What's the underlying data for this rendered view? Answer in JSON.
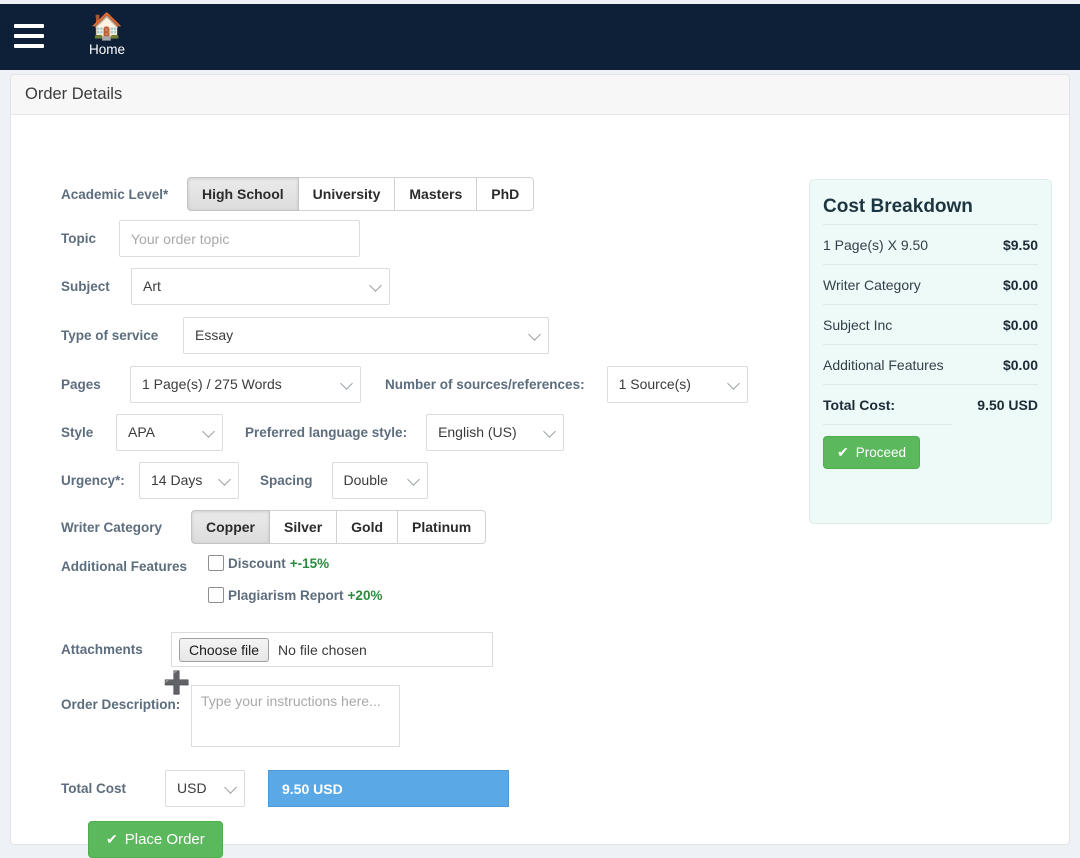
{
  "navbar": {
    "menu_icon": "hamburger-icon",
    "home_icon": "home-icon",
    "home_label": "Home"
  },
  "card": {
    "header_title": "Order Details"
  },
  "form": {
    "academic_level": {
      "label": "Academic Level*",
      "options": [
        "High School",
        "University",
        "Masters",
        "PhD"
      ],
      "selected": "High School"
    },
    "topic": {
      "label": "Topic",
      "placeholder": "Your order topic",
      "value": ""
    },
    "subject": {
      "label": "Subject",
      "value": "Art"
    },
    "type_of_service": {
      "label": "Type of service",
      "value": "Essay"
    },
    "pages": {
      "label": "Pages",
      "value": "1 Page(s) / 275 Words"
    },
    "sources": {
      "label": "Number of sources/references:",
      "value": "1 Source(s)"
    },
    "style": {
      "label": "Style",
      "value": "APA"
    },
    "language_style": {
      "label": "Preferred language style:",
      "value": "English (US)"
    },
    "urgency": {
      "label": "Urgency*:",
      "value": "14 Days"
    },
    "spacing": {
      "label": "Spacing",
      "value": "Double"
    },
    "writer_category": {
      "label": "Writer Category",
      "options": [
        "Copper",
        "Silver",
        "Gold",
        "Platinum"
      ],
      "selected": "Copper"
    },
    "additional_features": {
      "label": "Additional Features",
      "items": [
        {
          "name": "Discount",
          "percent": "+-15%",
          "checked": false
        },
        {
          "name": "Plagiarism Report",
          "percent": "+20%",
          "checked": false
        }
      ]
    },
    "attachments": {
      "label": "Attachments",
      "choose_button": "Choose file",
      "file_status": "No file chosen",
      "add_icon": "plus-icon"
    },
    "order_description": {
      "label": "Order Description:",
      "placeholder": "Type your instructions here...",
      "value": ""
    },
    "total_cost": {
      "label": "Total Cost",
      "currency": "USD",
      "amount": "9.50 USD"
    },
    "place_order": {
      "label": "Place Order",
      "icon": "check-icon"
    }
  },
  "cost_breakdown": {
    "title": "Cost Breakdown",
    "rows": [
      {
        "label": "1 Page(s) X 9.50",
        "amount": "$9.50"
      },
      {
        "label": "Writer Category",
        "amount": "$0.00"
      },
      {
        "label": "Subject Inc",
        "amount": "$0.00"
      },
      {
        "label": "Additional Features",
        "amount": "$0.00"
      }
    ],
    "total": {
      "label": "Total Cost:",
      "amount": "9.50 USD"
    },
    "proceed": {
      "label": "Proceed",
      "icon": "check-icon"
    }
  },
  "colors": {
    "navbar_bg": "#0e1f38",
    "panel_bg": "#eefaf8",
    "green": "#5cb85c",
    "blue": "#5aa9e6",
    "percent_green": "#2b8a3e",
    "label": "#5d6d7e"
  }
}
